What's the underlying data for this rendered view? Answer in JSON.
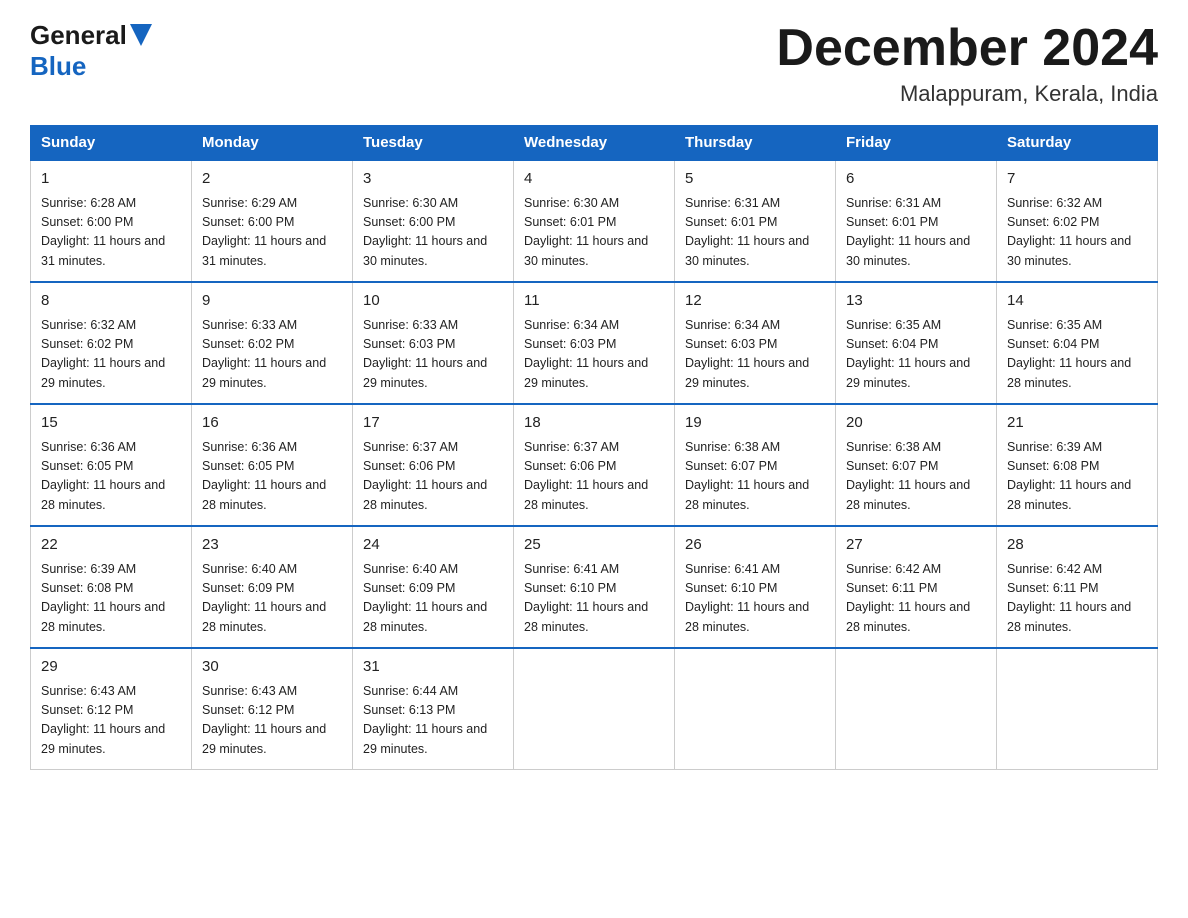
{
  "logo": {
    "general": "General",
    "blue": "Blue",
    "arrow_color": "#1565c0"
  },
  "title": "December 2024",
  "subtitle": "Malappuram, Kerala, India",
  "days": [
    "Sunday",
    "Monday",
    "Tuesday",
    "Wednesday",
    "Thursday",
    "Friday",
    "Saturday"
  ],
  "weeks": [
    [
      {
        "num": "1",
        "sunrise": "6:28 AM",
        "sunset": "6:00 PM",
        "daylight": "11 hours and 31 minutes."
      },
      {
        "num": "2",
        "sunrise": "6:29 AM",
        "sunset": "6:00 PM",
        "daylight": "11 hours and 31 minutes."
      },
      {
        "num": "3",
        "sunrise": "6:30 AM",
        "sunset": "6:00 PM",
        "daylight": "11 hours and 30 minutes."
      },
      {
        "num": "4",
        "sunrise": "6:30 AM",
        "sunset": "6:01 PM",
        "daylight": "11 hours and 30 minutes."
      },
      {
        "num": "5",
        "sunrise": "6:31 AM",
        "sunset": "6:01 PM",
        "daylight": "11 hours and 30 minutes."
      },
      {
        "num": "6",
        "sunrise": "6:31 AM",
        "sunset": "6:01 PM",
        "daylight": "11 hours and 30 minutes."
      },
      {
        "num": "7",
        "sunrise": "6:32 AM",
        "sunset": "6:02 PM",
        "daylight": "11 hours and 30 minutes."
      }
    ],
    [
      {
        "num": "8",
        "sunrise": "6:32 AM",
        "sunset": "6:02 PM",
        "daylight": "11 hours and 29 minutes."
      },
      {
        "num": "9",
        "sunrise": "6:33 AM",
        "sunset": "6:02 PM",
        "daylight": "11 hours and 29 minutes."
      },
      {
        "num": "10",
        "sunrise": "6:33 AM",
        "sunset": "6:03 PM",
        "daylight": "11 hours and 29 minutes."
      },
      {
        "num": "11",
        "sunrise": "6:34 AM",
        "sunset": "6:03 PM",
        "daylight": "11 hours and 29 minutes."
      },
      {
        "num": "12",
        "sunrise": "6:34 AM",
        "sunset": "6:03 PM",
        "daylight": "11 hours and 29 minutes."
      },
      {
        "num": "13",
        "sunrise": "6:35 AM",
        "sunset": "6:04 PM",
        "daylight": "11 hours and 29 minutes."
      },
      {
        "num": "14",
        "sunrise": "6:35 AM",
        "sunset": "6:04 PM",
        "daylight": "11 hours and 28 minutes."
      }
    ],
    [
      {
        "num": "15",
        "sunrise": "6:36 AM",
        "sunset": "6:05 PM",
        "daylight": "11 hours and 28 minutes."
      },
      {
        "num": "16",
        "sunrise": "6:36 AM",
        "sunset": "6:05 PM",
        "daylight": "11 hours and 28 minutes."
      },
      {
        "num": "17",
        "sunrise": "6:37 AM",
        "sunset": "6:06 PM",
        "daylight": "11 hours and 28 minutes."
      },
      {
        "num": "18",
        "sunrise": "6:37 AM",
        "sunset": "6:06 PM",
        "daylight": "11 hours and 28 minutes."
      },
      {
        "num": "19",
        "sunrise": "6:38 AM",
        "sunset": "6:07 PM",
        "daylight": "11 hours and 28 minutes."
      },
      {
        "num": "20",
        "sunrise": "6:38 AM",
        "sunset": "6:07 PM",
        "daylight": "11 hours and 28 minutes."
      },
      {
        "num": "21",
        "sunrise": "6:39 AM",
        "sunset": "6:08 PM",
        "daylight": "11 hours and 28 minutes."
      }
    ],
    [
      {
        "num": "22",
        "sunrise": "6:39 AM",
        "sunset": "6:08 PM",
        "daylight": "11 hours and 28 minutes."
      },
      {
        "num": "23",
        "sunrise": "6:40 AM",
        "sunset": "6:09 PM",
        "daylight": "11 hours and 28 minutes."
      },
      {
        "num": "24",
        "sunrise": "6:40 AM",
        "sunset": "6:09 PM",
        "daylight": "11 hours and 28 minutes."
      },
      {
        "num": "25",
        "sunrise": "6:41 AM",
        "sunset": "6:10 PM",
        "daylight": "11 hours and 28 minutes."
      },
      {
        "num": "26",
        "sunrise": "6:41 AM",
        "sunset": "6:10 PM",
        "daylight": "11 hours and 28 minutes."
      },
      {
        "num": "27",
        "sunrise": "6:42 AM",
        "sunset": "6:11 PM",
        "daylight": "11 hours and 28 minutes."
      },
      {
        "num": "28",
        "sunrise": "6:42 AM",
        "sunset": "6:11 PM",
        "daylight": "11 hours and 28 minutes."
      }
    ],
    [
      {
        "num": "29",
        "sunrise": "6:43 AM",
        "sunset": "6:12 PM",
        "daylight": "11 hours and 29 minutes."
      },
      {
        "num": "30",
        "sunrise": "6:43 AM",
        "sunset": "6:12 PM",
        "daylight": "11 hours and 29 minutes."
      },
      {
        "num": "31",
        "sunrise": "6:44 AM",
        "sunset": "6:13 PM",
        "daylight": "11 hours and 29 minutes."
      },
      null,
      null,
      null,
      null
    ]
  ]
}
